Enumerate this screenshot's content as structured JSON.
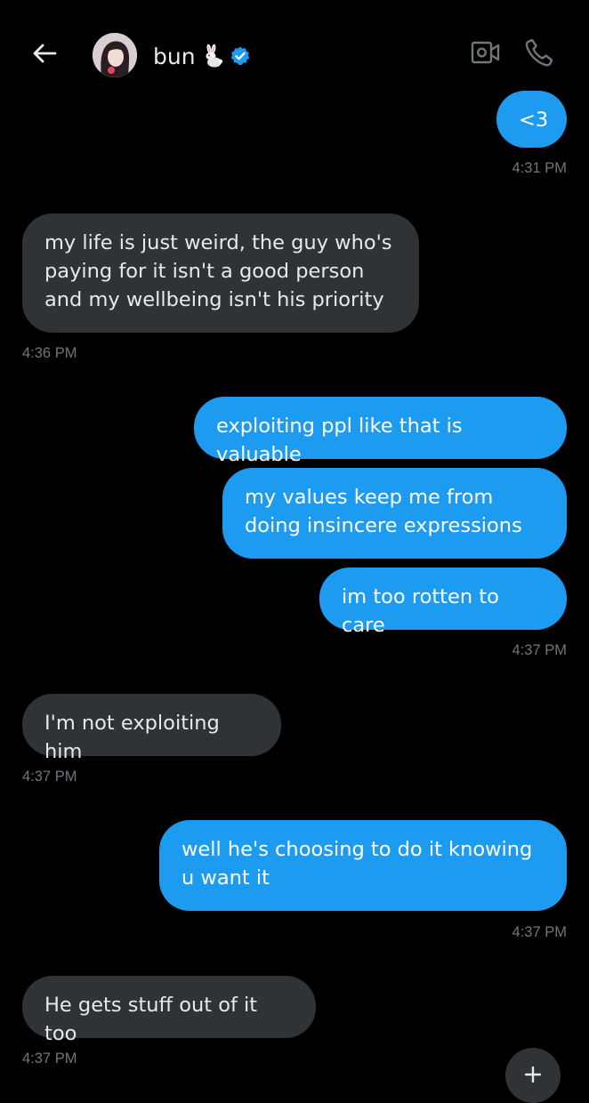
{
  "header": {
    "back_icon": "arrow-left-icon",
    "contact_name": "bun",
    "name_emoji_icon": "rabbit-emoji-icon",
    "verified_icon": "verified-badge-icon",
    "video_icon": "video-camera-icon",
    "call_icon": "phone-icon",
    "verified_color": "#1d9bf0"
  },
  "colors": {
    "background": "#000000",
    "outgoing_bubble": "#1d9bf0",
    "incoming_bubble": "#2f3336",
    "timestamp": "#71767b",
    "text": "#e7e9ea"
  },
  "messages": [
    {
      "direction": "outgoing",
      "text": "<3"
    },
    {
      "timestamp": "4:31 PM"
    },
    {
      "direction": "incoming",
      "text": "my life is just weird, the guy who's paying for it isn't a good person and my wellbeing isn't his priority"
    },
    {
      "timestamp": "4:36 PM"
    },
    {
      "direction": "outgoing",
      "text": "exploiting ppl like that is valuable"
    },
    {
      "direction": "outgoing",
      "text": "my values keep me from doing insincere expressions"
    },
    {
      "direction": "outgoing",
      "text": "im too rotten to care"
    },
    {
      "timestamp": "4:37 PM"
    },
    {
      "direction": "incoming",
      "text": "I'm not exploiting him"
    },
    {
      "timestamp": "4:37 PM"
    },
    {
      "direction": "outgoing",
      "text": "well he's choosing to do it knowing u want it"
    },
    {
      "timestamp": "4:37 PM"
    },
    {
      "direction": "incoming",
      "text": "He gets stuff out of it too"
    },
    {
      "timestamp": "4:37 PM"
    }
  ],
  "fab_icon": "plus-icon"
}
